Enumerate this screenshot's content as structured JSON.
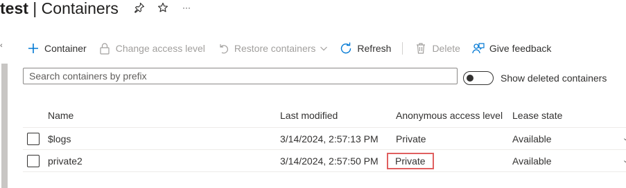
{
  "header": {
    "title_strong": "test",
    "title_rest": " | Containers",
    "icons": [
      "pin-icon",
      "star-icon",
      "more-icon"
    ],
    "more_text": "···"
  },
  "toolbar": {
    "items": [
      {
        "label": "Container",
        "icon": "add-icon",
        "enabled": true
      },
      {
        "label": "Change access level",
        "icon": "lock-icon",
        "enabled": false
      },
      {
        "label": "Restore containers",
        "icon": "undo-icon",
        "enabled": false,
        "dropdown": true
      },
      {
        "label": "Refresh",
        "icon": "refresh-icon",
        "enabled": true
      },
      {
        "label": "Delete",
        "icon": "trash-icon",
        "enabled": false
      },
      {
        "label": "Give feedback",
        "icon": "feedback-icon",
        "enabled": true
      }
    ]
  },
  "search": {
    "placeholder": "Search containers by prefix",
    "value": ""
  },
  "toggle": {
    "label": "Show deleted containers",
    "on": false
  },
  "table": {
    "columns": [
      "Name",
      "Last modified",
      "Anonymous access level",
      "Lease state"
    ],
    "rows": [
      {
        "name": "$logs",
        "modified": "3/14/2024, 2:57:13 PM",
        "access": "Private",
        "lease": "Available"
      },
      {
        "name": "private2",
        "modified": "3/14/2024, 2:57:50 PM",
        "access": "Private",
        "lease": "Available"
      }
    ]
  },
  "colors": {
    "accent": "#0078d4",
    "highlight_border": "#e05f5f",
    "disabled_text": "#a19f9d"
  }
}
